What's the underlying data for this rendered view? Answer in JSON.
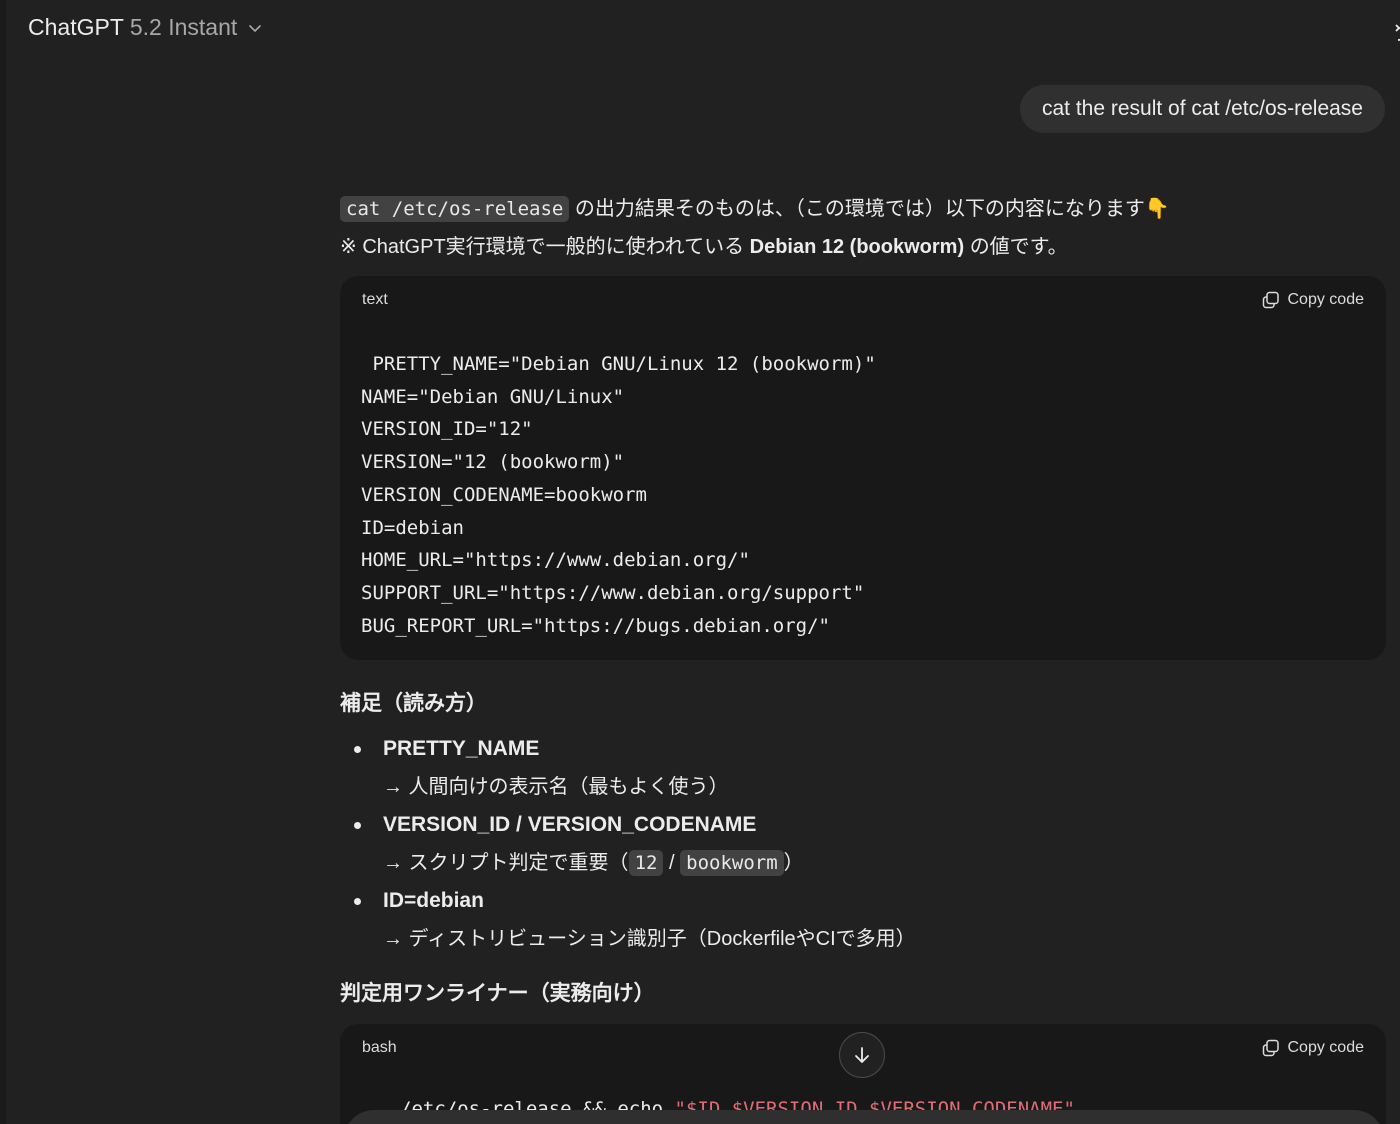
{
  "header": {
    "model_name": "ChatGPT",
    "model_version": "5.2 Instant"
  },
  "user_message": "cat the result of cat /etc/os-release",
  "assistant": {
    "intro_code": "cat /etc/os-release",
    "intro_text": "の出力結果そのものは、（この環境では）以下の内容になります👇",
    "note_prefix": "※ ChatGPT実行環境で一般的に使われている",
    "note_bold": "Debian 12 (bookworm)",
    "note_suffix": "の値です。",
    "code_block": {
      "language": "text",
      "copy_label": "Copy code",
      "content": " PRETTY_NAME=\"Debian GNU/Linux 12 (bookworm)\"\nNAME=\"Debian GNU/Linux\"\nVERSION_ID=\"12\"\nVERSION=\"12 (bookworm)\"\nVERSION_CODENAME=bookworm\nID=debian\nHOME_URL=\"https://www.debian.org/\"\nSUPPORT_URL=\"https://www.debian.org/support\"\nBUG_REPORT_URL=\"https://bugs.debian.org/\""
    },
    "supplement_heading": "補足（読み方）",
    "notes": [
      {
        "title": "PRETTY_NAME",
        "desc": "→ 人間向けの表示名（最もよく使う）"
      },
      {
        "title": "VERSION_ID / VERSION_CODENAME",
        "desc_prefix": "→ スクリプト判定で重要（",
        "desc_code1": "12",
        "desc_sep": "/",
        "desc_code2": "bookworm",
        "desc_suffix": "）"
      },
      {
        "title": "ID=debian",
        "desc": "→ ディストリビューション識別子（DockerfileやCIで多用）"
      }
    ],
    "oneliner_heading": "判定用ワンライナー（実務向け）",
    "bash_block": {
      "language": "bash",
      "copy_label": "Copy code",
      "line_plain": "/etc/os-release && echo ",
      "line_string": "\"$ID $VERSION_ID $VERSION_CODENAME\""
    }
  },
  "colors": {
    "background": "#212121",
    "code_background": "#181818",
    "bubble": "#303030",
    "inline_code": "#424242",
    "string": "#e06c75"
  },
  "icons": [
    "chevron-down-icon",
    "share-icon",
    "copy-icon",
    "arrow-down-icon"
  ]
}
